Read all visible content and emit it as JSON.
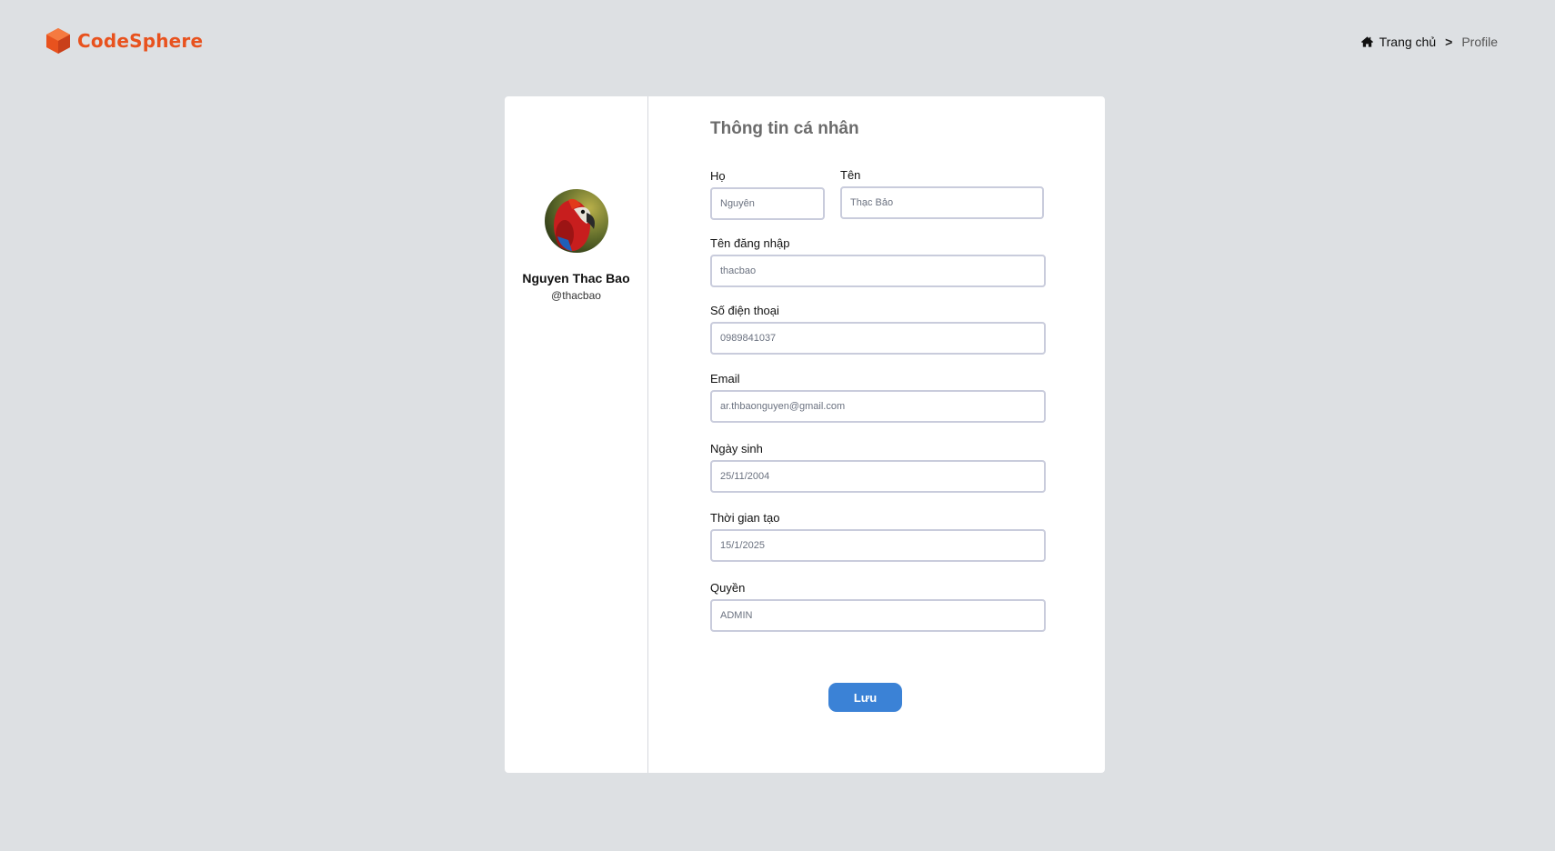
{
  "brand": {
    "name": "CodeSphere",
    "color": "#e8521e"
  },
  "breadcrumb": {
    "home_icon": "home-icon",
    "home": "Trang chủ",
    "separator": ">",
    "current": "Profile"
  },
  "profile": {
    "avatar_icon": "parrot-avatar",
    "name": "Nguyen Thac Bao",
    "handle": "@thacbao"
  },
  "form": {
    "title": "Thông tin cá nhân",
    "last_name": {
      "label": "Họ",
      "value": "Nguyên"
    },
    "first_name": {
      "label": "Tên",
      "value": "Thạc Bảo"
    },
    "username": {
      "label": "Tên đăng nhập",
      "value": "thacbao"
    },
    "phone": {
      "label": "Số điện thoại",
      "value": "0989841037"
    },
    "email": {
      "label": "Email",
      "value": "ar.thbaonguyen@gmail.com"
    },
    "birthday": {
      "label": "Ngày sinh",
      "value": "25/11/2004"
    },
    "created": {
      "label": "Thời gian tạo",
      "value": "15/1/2025"
    },
    "role": {
      "label": "Quyền",
      "value": "ADMIN"
    },
    "save_label": "Lưu"
  },
  "colors": {
    "background": "#dde0e3",
    "accent": "#3b82d6",
    "brand": "#e8521e"
  }
}
